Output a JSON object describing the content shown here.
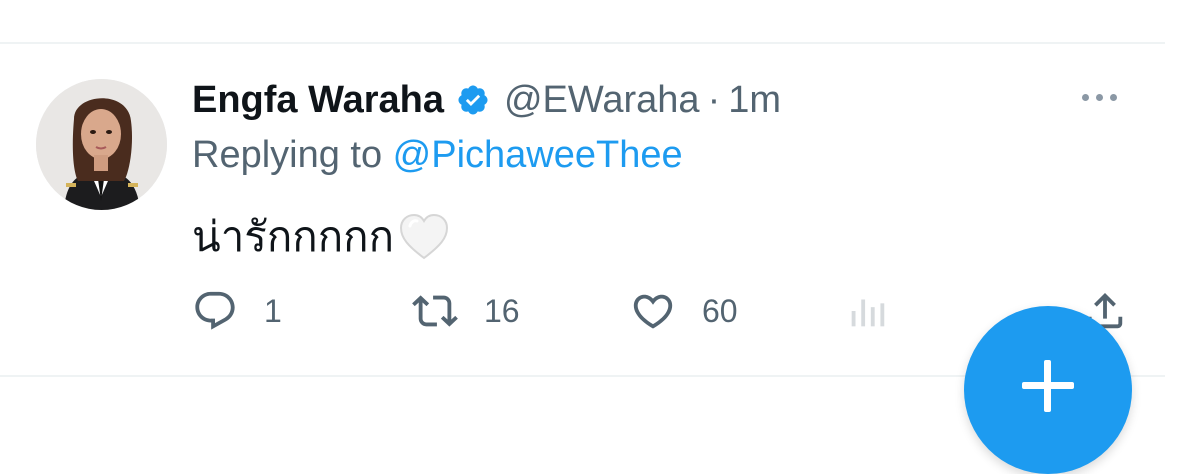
{
  "tweet": {
    "author_name": "Engfa Waraha",
    "handle": "@EWaraha",
    "separator": "·",
    "time": "1m",
    "replying_prefix": "Replying to ",
    "replying_to": "@PichaweeThee",
    "text": "น่ารักกกกก",
    "emoji": "white-heart-emoji",
    "verified": true
  },
  "actions": {
    "reply_count": "1",
    "retweet_count": "16",
    "like_count": "60"
  },
  "colors": {
    "accent": "#1d9bf0",
    "secondary_text": "#536471",
    "primary_text": "#0f1419",
    "divider": "#eff3f4"
  },
  "icons": {
    "reply": "reply-icon",
    "retweet": "retweet-icon",
    "like": "like-heart-icon",
    "views": "views-analytics-icon",
    "share": "share-icon",
    "more": "more-dots-icon",
    "compose": "compose-plus-icon"
  }
}
